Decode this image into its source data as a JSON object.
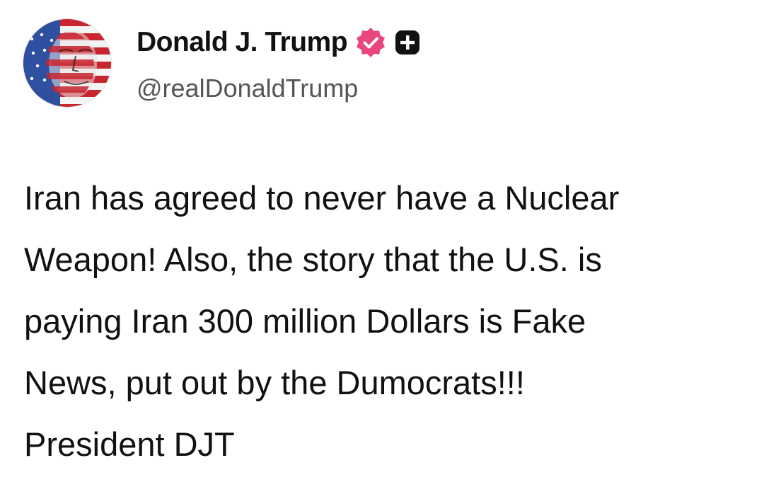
{
  "post": {
    "author": {
      "display_name": "Donald J. Trump",
      "handle": "@realDonaldTrump",
      "verified_badge_icon": "verified-badge-icon",
      "subscription_badge_icon": "plus-badge-icon",
      "avatar_icon": "flag-portrait-avatar"
    },
    "body_lines": [
      "Iran has agreed to never have a Nuclear",
      "Weapon! Also, the story that the U.S. is",
      "paying Iran 300 million Dollars is Fake",
      "News, put out by the Dumocrats!!!",
      "President DJT"
    ]
  },
  "colors": {
    "verified_badge": "#e8467c",
    "plus_badge": "#111111",
    "text": "#111111",
    "handle": "#555555"
  }
}
